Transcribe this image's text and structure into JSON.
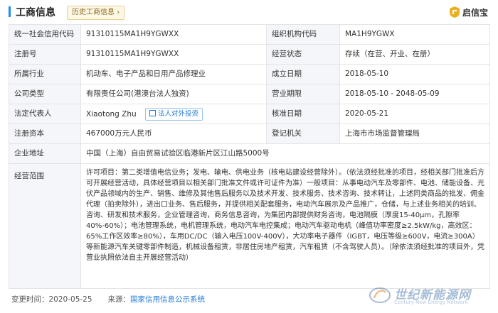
{
  "header": {
    "title": "工商信息",
    "history_button": "历史工商信息",
    "logo_text": "启信宝"
  },
  "rows": [
    {
      "l1": "统一社会信用代码",
      "v1": "91310115MA1H9YGWXX",
      "l2": "组织机构代码",
      "v2": "MA1H9YGWX"
    },
    {
      "l1": "注册号",
      "v1": "91310115MA1H9YGWXX",
      "l2": "经营状态",
      "v2": "存续（在营、开业、在册）"
    },
    {
      "l1": "所属行业",
      "v1": "机动车、电子产品和日用产品修理业",
      "l2": "成立日期",
      "v2": "2018-05-10"
    },
    {
      "l1": "公司类型",
      "v1": "有限责任公司(港澳台法人独资)",
      "l2": "营业期限",
      "v2": "2018-05-10 - 2048-05-09"
    },
    {
      "l1": "法定代表人",
      "v1": "Xiaotong Zhu",
      "btn": "法人对外投资",
      "l2": "核准日期",
      "v2": "2020-05-21"
    },
    {
      "l1": "注册资本",
      "v1": "467000万元人民币",
      "l2": "登记机关",
      "v2": "上海市市场监督管理局"
    }
  ],
  "address": {
    "label": "企业地址",
    "value": "中国（上海）自由贸易试验区临港新片区江山路5000号"
  },
  "scope": {
    "label": "经营范围",
    "value": "许可项目：第二类增值电信业务；发电、输电、供电业务（核电站建设经营除外）。（依法须经批准的项目，经相关部门批准后方可开展经营活动，具体经营项目以相关部门批准文件或许可证件为准）一般项目：从事电动汽车及零部件、电池、储能设备、光伏产品领域内的生产、销售、维修及其他售后服务以及技术开发、技术服务、技术咨询、技术转让，上述同类商品的批发、佣金代理（拍卖除外），进出口业务、售后服务，并提供相关配套服务，电动汽车展示及产品推广，仓储，与上述业务相关的培训、咨询、研发和技术服务，企业管理咨询，商务信息咨询，为集团内部提供财务咨询，电池隔膜（厚度15-40μm，孔隙率40%-60%）；电池管理系统，电机管理系统，电动汽车电控集成；电动汽车驱动电机（峰值功率密度≥2.5kW/kg，高效区：65%工作区效率≥80%），车用DC/DC（输入电压100V-400V），大功率电子器件（IGBT，电压等级≥600V，电流≥300A）等新能源汽车关键零部件制造，机械设备租赁，非居住房地产租赁，汽车租赁（不含驾驶人员）。（除依法须经批准的项目外，凭营业执照依法自主开展经营活动）"
  },
  "footer": {
    "date_label": "变更时间：2020-05-25",
    "source_label": "来源：",
    "source_link": "国家信用信息公示系统"
  },
  "watermark": {
    "main": "世纪新能源网",
    "sub": "Century New Energy Network"
  },
  "colors": {
    "accent": "#1f8ceb",
    "label_bg": "#f4f6fa",
    "border": "#e4e4e4",
    "link": "#1f7ad6"
  }
}
